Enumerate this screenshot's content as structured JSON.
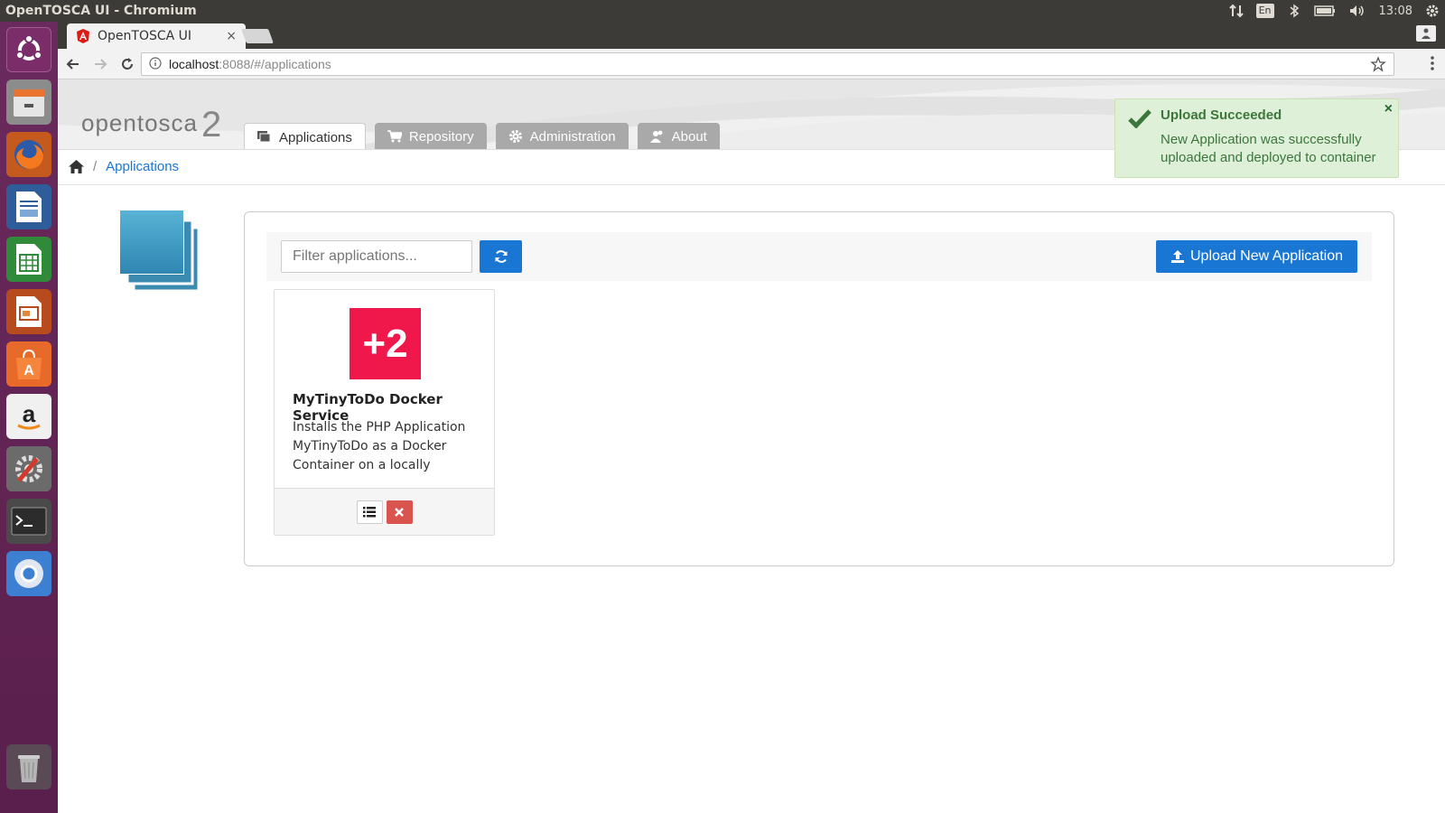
{
  "os": {
    "window_title": "OpenTOSCA UI - Chromium",
    "keyboard_layout": "En",
    "clock": "13:08"
  },
  "launcher": {
    "items": [
      "ubuntu-dash",
      "files",
      "firefox",
      "libreoffice-writer",
      "libreoffice-calc",
      "libreoffice-impress",
      "ubuntu-software",
      "amazon",
      "system-settings",
      "terminal",
      "chromium",
      "trash"
    ]
  },
  "browser": {
    "tab_title": "OpenTOSCA UI",
    "tab_close": "×",
    "url_host": "localhost",
    "url_rest": ":8088/#/applications"
  },
  "app": {
    "logo_text": "opentosca",
    "logo_version": "2",
    "nav_tabs": [
      {
        "label": "Applications",
        "icon": "applications-icon"
      },
      {
        "label": "Repository",
        "icon": "cart-icon"
      },
      {
        "label": "Administration",
        "icon": "gear-icon"
      },
      {
        "label": "About",
        "icon": "users-icon"
      }
    ],
    "breadcrumb": {
      "separator": "/",
      "current": "Applications"
    },
    "filter_placeholder": "Filter applications...",
    "upload_label": "Upload New Application",
    "applications": [
      {
        "logo_text": "+2",
        "name": "MyTinyToDo Docker Service",
        "description": "Installs the PHP Application MyTinyToDo as a Docker Container on a locally install..."
      }
    ]
  },
  "toast": {
    "title": "Upload Succeeded",
    "message": "New Application was successfully uploaded and deployed to container",
    "close": "×"
  },
  "colors": {
    "primary": "#1976d2",
    "danger": "#d9534f",
    "success_bg": "#dff0d8",
    "success_text": "#3c763d",
    "launcher_bg": "#5e2750"
  }
}
